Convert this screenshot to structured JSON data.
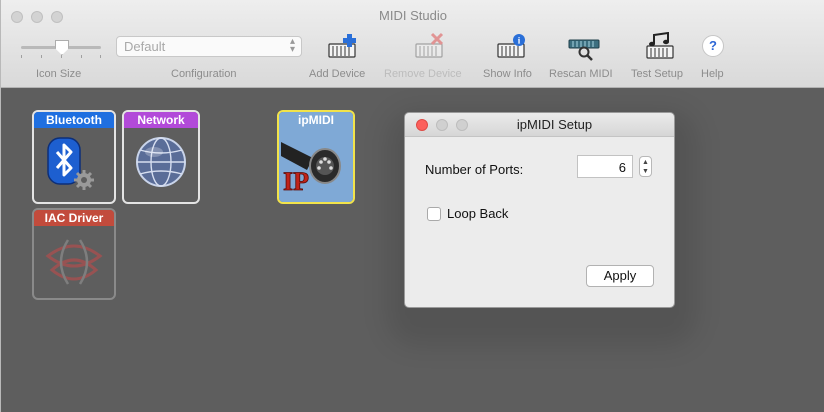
{
  "window": {
    "title": "MIDI Studio"
  },
  "toolbar": {
    "icon_size_label": "Icon Size",
    "configuration_label": "Configuration",
    "configuration_value": "Default",
    "add_device_label": "Add Device",
    "remove_device_label": "Remove Device",
    "show_info_label": "Show Info",
    "rescan_midi_label": "Rescan MIDI",
    "test_setup_label": "Test Setup",
    "help_label": "Help",
    "help_glyph": "?"
  },
  "devices": [
    {
      "label": "Bluetooth",
      "label_color": "#1f6fe0",
      "icon": "bluetooth-icon"
    },
    {
      "label": "Network",
      "label_color": "#b24ad9",
      "icon": "network-globe-icon"
    },
    {
      "label": "ipMIDI",
      "label_color": "#7fa9d6",
      "icon": "ipmidi-connector-icon",
      "selected": true
    },
    {
      "label": "IAC Driver",
      "label_color": "#c24b3c",
      "icon": "iac-driver-icon",
      "dimmed": true
    }
  ],
  "dialog": {
    "title": "ipMIDI Setup",
    "ports_label": "Number of Ports:",
    "ports_value": "6",
    "loop_back_label": "Loop Back",
    "loop_back_checked": false,
    "apply_label": "Apply"
  },
  "colors": {
    "canvas": "#5e5e5e",
    "selection": "#f2e34a",
    "close_red": "#fc605c"
  }
}
